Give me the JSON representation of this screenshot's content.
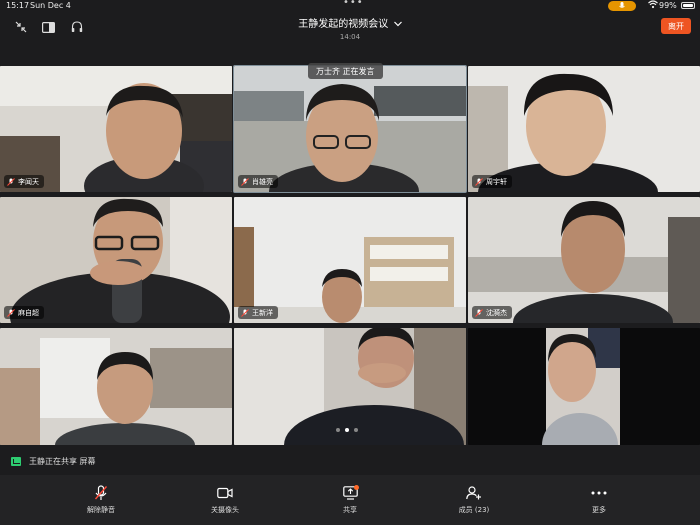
{
  "status_bar": {
    "time": "15:17",
    "date": "Sun Dec 4",
    "battery": "99%"
  },
  "meeting": {
    "title": "王静发起的视频会议",
    "duration": "14:04",
    "leave_label": "离开",
    "speaking_label": "万士齐 正在发言"
  },
  "participants": [
    {
      "name": "李闻天"
    },
    {
      "name": "肖雄亮"
    },
    {
      "name": "周宇轩"
    },
    {
      "name": "麻自超"
    },
    {
      "name": "王新洋"
    },
    {
      "name": "沈漪杰"
    },
    {
      "name": ""
    },
    {
      "name": ""
    },
    {
      "name": ""
    }
  ],
  "share_banner": {
    "text": "王静正在共享 屏幕"
  },
  "toolbar": {
    "unmute_label": "解除静音",
    "camera_label": "关摄像头",
    "share_label": "共享",
    "members_label": "成员 (23)",
    "more_label": "更多"
  },
  "colors": {
    "accent": "#ee5522",
    "share_green": "#2ecc71",
    "background": "#1c1c1e"
  }
}
